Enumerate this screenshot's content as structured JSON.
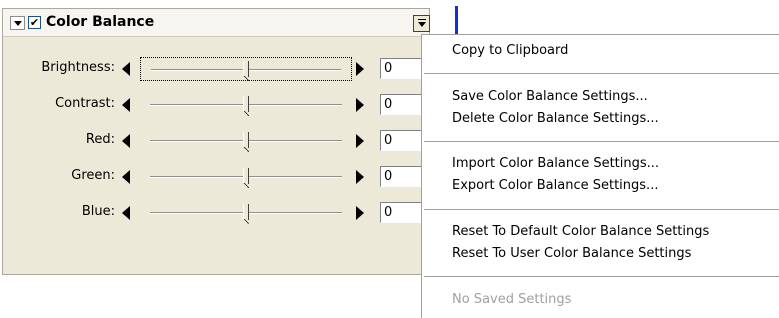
{
  "panel": {
    "title": "Color Balance",
    "enabled_check": "✔",
    "sliders": [
      {
        "label": "Brightness:",
        "value": "0",
        "position": 0.5,
        "focused": true
      },
      {
        "label": "Contrast:",
        "value": "0",
        "position": 0.5,
        "focused": false
      },
      {
        "label": "Red:",
        "value": "0",
        "position": 0.5,
        "focused": false
      },
      {
        "label": "Green:",
        "value": "0",
        "position": 0.5,
        "focused": false
      },
      {
        "label": "Blue:",
        "value": "0",
        "position": 0.5,
        "focused": false
      }
    ]
  },
  "menu": {
    "groups": [
      [
        "Copy to Clipboard"
      ],
      [
        "Save Color Balance Settings...",
        "Delete Color Balance Settings..."
      ],
      [
        "Import Color Balance Settings...",
        "Export Color Balance Settings..."
      ],
      [
        "Reset To Default Color Balance Settings",
        "Reset To User Color Balance Settings"
      ],
      [
        "No Saved Settings"
      ]
    ]
  },
  "colors": {
    "panel_bg": "#ece9d8",
    "accent_line": "#1030c8",
    "disabled_text": "#a0a0a0"
  }
}
